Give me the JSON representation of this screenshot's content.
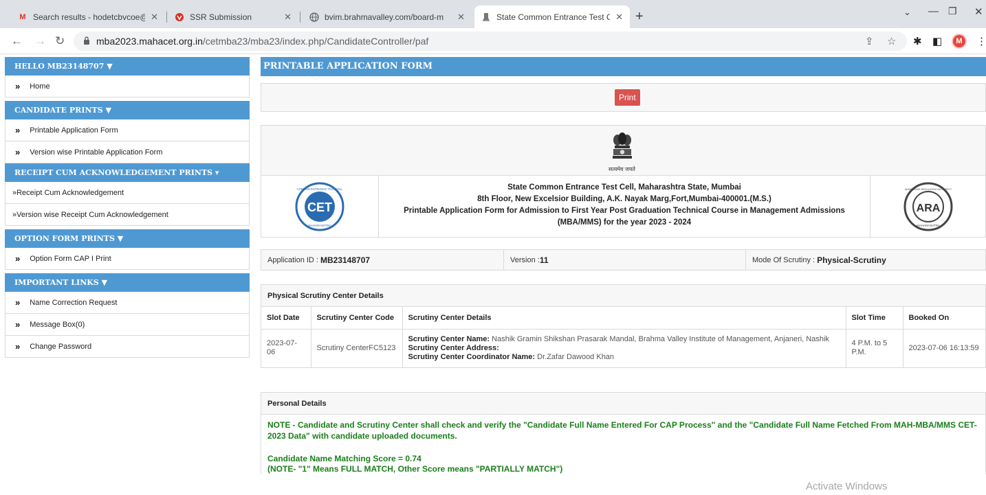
{
  "browser": {
    "tabs": [
      {
        "title": "Search results - hodetcbvcoe@g",
        "icon": "gmail-icon"
      },
      {
        "title": "SSR Submission",
        "icon": "ssr-icon"
      },
      {
        "title": "bvim.brahmavalley.com/board-m",
        "icon": "globe-icon"
      },
      {
        "title": "State Common Entrance Test Cell",
        "icon": "emblem-icon"
      }
    ],
    "url_host": "mba2023.mahacet.org.in",
    "url_path": "/cetmba23/mba23/index.php/CandidateController/paf",
    "profile_initial": "M"
  },
  "sidebar": {
    "greeting": "HELLO MB23148707 ▼",
    "home": "Home",
    "sections": [
      {
        "title": "CANDIDATE PRINTS ▼",
        "items": [
          "Printable Application Form",
          "Version wise Printable Application Form"
        ]
      },
      {
        "title": "RECEIPT CUM ACKNOWLEDGEMENT PRINTS ▾",
        "items": [
          "»Receipt Cum Acknowledgement",
          "»Version wise Receipt Cum Acknowledgement"
        ]
      },
      {
        "title": "OPTION FORM PRINTS ▼",
        "items": [
          "Option Form CAP I Print"
        ]
      },
      {
        "title": "IMPORTANT LINKS ▼",
        "items": [
          "Name Correction Request",
          "Message Box(0)",
          "Change Password"
        ]
      }
    ]
  },
  "main": {
    "page_title": "PRINTABLE APPLICATION FORM",
    "print_label": "Print",
    "emblem_caption": "सत्यमेव जयते",
    "org_lines": [
      "State Common Entrance Test Cell, Maharashtra State, Mumbai",
      "8th Floor, New Excelsior Building, A.K. Nayak Marg,Fort,Mumbai-400001.(M.S.)",
      "Printable Application Form for Admission to First Year Post Graduation Technical Course in Management Admissions",
      "(MBA/MMS) for the year 2023 - 2024"
    ],
    "left_logo_text": "CET",
    "left_logo_ring": "COMMON ENTRANCE TEST CELL",
    "left_logo_bottom": "MAHARASHTRA",
    "right_logo_text": "ARA",
    "right_logo_ring": "ADMISSIONS REGULATING AUTHORITY",
    "right_logo_bottom": "MAHARASHTRA",
    "application_id_label": "Application ID :",
    "application_id": "MB23148707",
    "version_label": "Version :",
    "version": "11",
    "scrutiny_mode_label": "Mode Of Scrutiny :",
    "scrutiny_mode": "Physical-Scrutiny",
    "scrutiny_section_title": "Physical Scrutiny Center Details",
    "scrutiny_headers": [
      "Slot Date",
      "Scrutiny Center Code",
      "Scrutiny Center Details",
      "Slot Time",
      "Booked On"
    ],
    "scrutiny_row": {
      "slot_date": "2023-07-06",
      "center_code": "Scrutiny CenterFC5123",
      "name_label": "Scrutiny Center Name:",
      "name": "Nashik Gramin Shikshan Prasarak Mandal, Brahma Valley Institute of Management, Anjaneri, Nashik",
      "address_label": "Scrutiny Center Address:",
      "coordinator_label": "Scrutiny Center Coordinator Name:",
      "coordinator": "Dr.Zafar Dawood Khan",
      "slot_time": "4 P.M. to 5 P.M.",
      "booked_on": "2023-07-06 16:13:59"
    },
    "personal_title": "Personal Details",
    "note": "NOTE - Candidate and Scrutiny Center shall check and verify the \"Candidate Full Name Entered For CAP Process\" and the \"Candidate Full Name Fetched From MAH-MBA/MMS CET-2023 Data\" with candidate uploaded documents.",
    "score_line": "Candidate Name Matching Score = 0.74",
    "score_note": "(NOTE- \"1\" Means FULL MATCH, Other Score means \"PARTIALLY MATCH\")"
  },
  "watermark": "Activate Windows",
  "colors": {
    "header_blue": "#4f99d3",
    "print_red": "#d9534f",
    "note_green": "#1a7f1a"
  }
}
